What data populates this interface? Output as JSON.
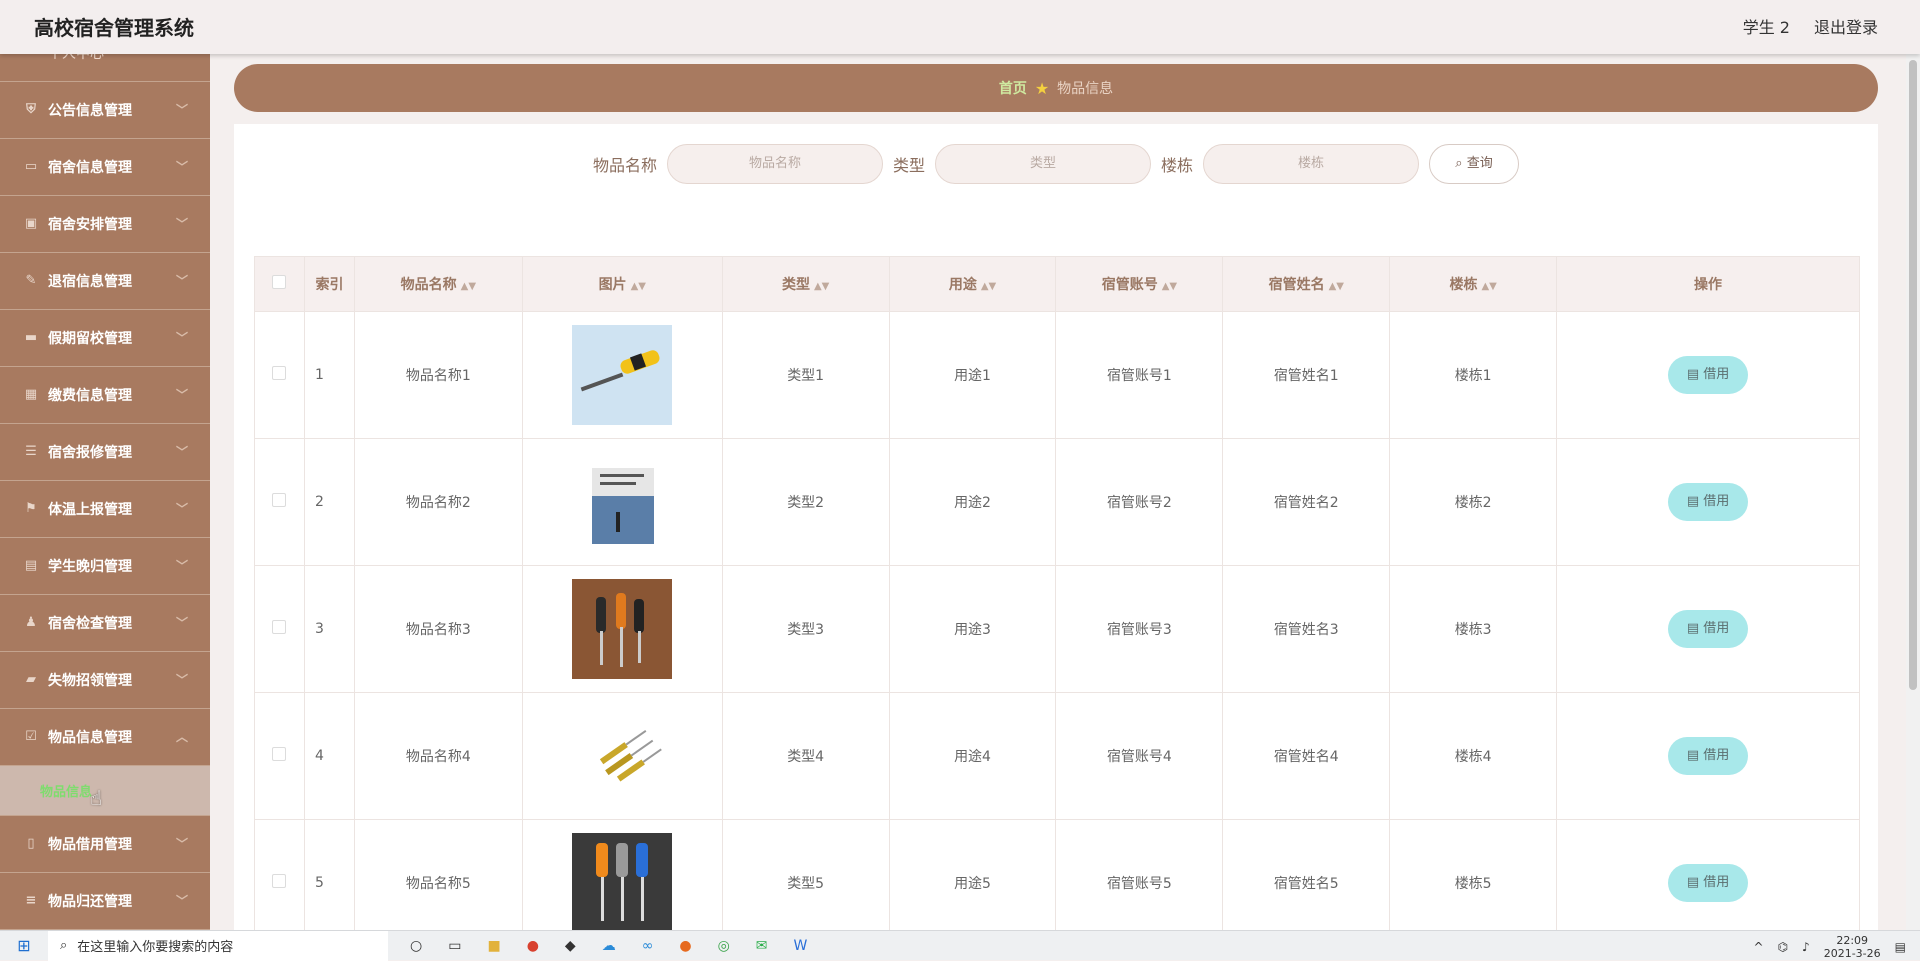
{
  "header": {
    "title": "高校宿舍管理系统",
    "user": "学生 2",
    "logout": "退出登录"
  },
  "sidebar": {
    "partial": "个人中心",
    "items": [
      {
        "label": "公告信息管理",
        "icon": "shield-icon"
      },
      {
        "label": "宿舍信息管理",
        "icon": "card-icon"
      },
      {
        "label": "宿舍安排管理",
        "icon": "briefcase-icon"
      },
      {
        "label": "退宿信息管理",
        "icon": "mic-icon"
      },
      {
        "label": "假期留校管理",
        "icon": "book-icon"
      },
      {
        "label": "缴费信息管理",
        "icon": "grid-icon"
      },
      {
        "label": "宿舍报修管理",
        "icon": "sliders-icon"
      },
      {
        "label": "体温上报管理",
        "icon": "flag-icon"
      },
      {
        "label": "学生晚归管理",
        "icon": "clipboard-icon"
      },
      {
        "label": "宿舍检查管理",
        "icon": "user-icon"
      },
      {
        "label": "失物招领管理",
        "icon": "ticket-icon"
      },
      {
        "label": "物品信息管理",
        "icon": "check-square-icon"
      }
    ],
    "active_sub": "物品信息",
    "items_after": [
      {
        "label": "物品借用管理",
        "icon": "phone-icon"
      },
      {
        "label": "物品归还管理",
        "icon": "list-icon"
      }
    ]
  },
  "breadcrumb": {
    "home": "首页",
    "current": "物品信息"
  },
  "search": {
    "name_label": "物品名称",
    "name_placeholder": "物品名称",
    "type_label": "类型",
    "type_placeholder": "类型",
    "building_label": "楼栋",
    "building_placeholder": "楼栋",
    "button": "查询"
  },
  "table": {
    "headers": [
      "索引",
      "物品名称",
      "图片",
      "类型",
      "用途",
      "宿管账号",
      "宿管姓名",
      "楼栋",
      "操作"
    ],
    "action_label": "借用",
    "rows": [
      {
        "index": "1",
        "name": "物品名称1",
        "image": "yellow-screwdriver",
        "type": "类型1",
        "use": "用途1",
        "account": "宿管账号1",
        "manager": "宿管姓名1",
        "building": "楼栋1"
      },
      {
        "index": "2",
        "name": "物品名称2",
        "image": "book-cover",
        "type": "类型2",
        "use": "用途2",
        "account": "宿管账号2",
        "manager": "宿管姓名2",
        "building": "楼栋2"
      },
      {
        "index": "3",
        "name": "物品名称3",
        "image": "screwdrivers-on-wood",
        "type": "类型3",
        "use": "用途3",
        "account": "宿管账号3",
        "manager": "宿管姓名3",
        "building": "楼栋3"
      },
      {
        "index": "4",
        "name": "物品名称4",
        "image": "screwdriver-set",
        "type": "类型4",
        "use": "用途4",
        "account": "宿管账号4",
        "manager": "宿管姓名4",
        "building": "楼栋4"
      },
      {
        "index": "5",
        "name": "物品名称5",
        "image": "screwdrivers-colored",
        "type": "类型5",
        "use": "用途5",
        "account": "宿管账号5",
        "manager": "宿管姓名5",
        "building": "楼栋5"
      }
    ]
  },
  "taskbar": {
    "search_placeholder": "在这里输入你要搜索的内容",
    "time": "22:09",
    "date": "2021-3-26"
  }
}
